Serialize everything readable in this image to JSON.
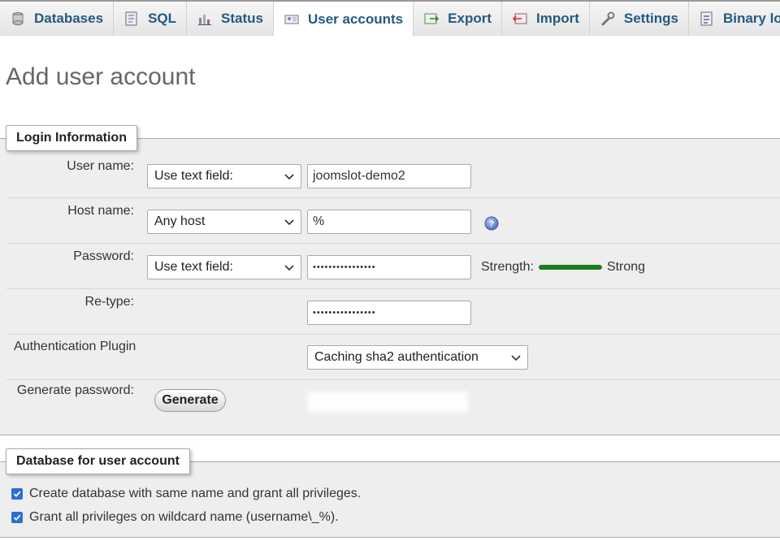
{
  "tabs": [
    {
      "label": "Databases",
      "icon": "database-icon"
    },
    {
      "label": "SQL",
      "icon": "sql-icon"
    },
    {
      "label": "Status",
      "icon": "status-icon"
    },
    {
      "label": "User accounts",
      "icon": "users-icon",
      "active": true
    },
    {
      "label": "Export",
      "icon": "export-icon"
    },
    {
      "label": "Import",
      "icon": "import-icon"
    },
    {
      "label": "Settings",
      "icon": "wrench-icon"
    },
    {
      "label": "Binary log",
      "icon": "binary-log-icon"
    }
  ],
  "page_title": "Add user account",
  "login": {
    "legend": "Login Information",
    "user_name": {
      "label": "User name:",
      "select": "Use text field:",
      "value": "joomslot-demo2"
    },
    "host_name": {
      "label": "Host name:",
      "select": "Any host",
      "value": "%"
    },
    "password": {
      "label": "Password:",
      "select": "Use text field:",
      "value": "••••••••••••••••",
      "strength_label": "Strength:",
      "strength_value": "Strong"
    },
    "retype": {
      "label": "Re-type:",
      "value": "••••••••••••••••"
    },
    "auth_plugin": {
      "label": "Authentication Plugin",
      "select": "Caching sha2 authentication"
    },
    "generate": {
      "label": "Generate password:",
      "button": "Generate"
    }
  },
  "database": {
    "legend": "Database for user account",
    "options": [
      {
        "label": "Create database with same name and grant all privileges.",
        "checked": true
      },
      {
        "label": "Grant all privileges on wildcard name (username\\_%).",
        "checked": true
      }
    ]
  },
  "colors": {
    "link": "#235a81",
    "strength_bar": "#1d7d1d",
    "checkbox": "#2b6fd1"
  }
}
